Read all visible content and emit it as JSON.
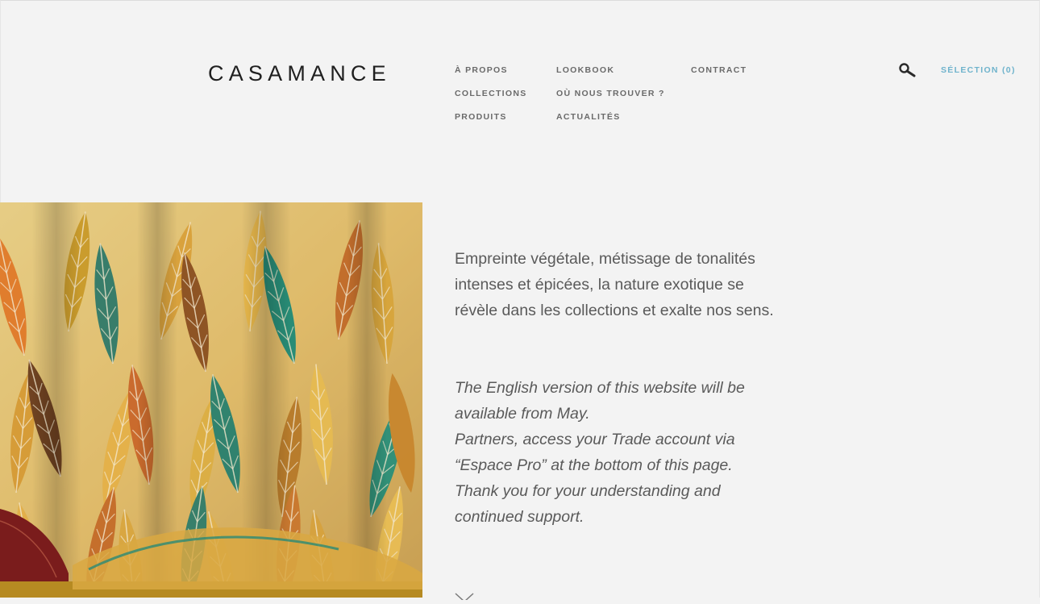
{
  "header": {
    "logo": "CASAMANCE",
    "nav": {
      "about": "À PROPOS",
      "collections": "COLLECTIONS",
      "products": "PRODUITS",
      "lookbook": "LOOKBOOK",
      "where_to_find": "OÙ NOUS TROUVER ?",
      "news": "ACTUALITÉS",
      "contract": "CONTRACT"
    },
    "search_icon": "search-icon",
    "selection": "SÉLECTION (0)",
    "accent_color": "#6fb3cc"
  },
  "hero": {
    "image": "tropical-leaf-print-fabric",
    "intro": "Empreinte végétale, métissage de tonalités intenses et épicées, la nature exotique se révèle dans les collections et exalte nos sens.",
    "notice": {
      "line1": "The English version of this website will be available from May.",
      "line2": "Partners, access your Trade account via “Espace Pro” at the bottom of this page.",
      "line3": "Thank you for your understanding and continued support."
    },
    "scroll_icon": "chevron-down-icon"
  }
}
